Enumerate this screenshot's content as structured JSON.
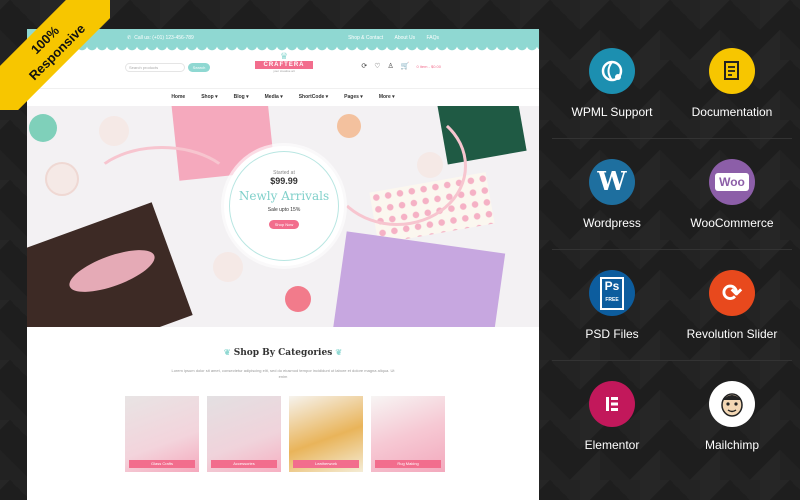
{
  "ribbon": {
    "line1": "100%",
    "line2": "Responsive"
  },
  "site": {
    "topbar": {
      "phone": "Call us: (+01) 123-456-789",
      "links": [
        "Shop & Contact",
        "About Us",
        "FAQs"
      ]
    },
    "search": {
      "placeholder": "Search products",
      "button": "Search"
    },
    "logo": {
      "name": "CRAFTERA",
      "tagline": "your creative art"
    },
    "cart": "0 item - $0.00",
    "nav": [
      "Home",
      "Shop ▾",
      "Blog ▾",
      "Media ▾",
      "ShortCode ▾",
      "Pages ▾",
      "More ▾"
    ],
    "hero": {
      "started": "Started at",
      "price": "$99.99",
      "title": "Newly Arrivals",
      "sale": "Sale upto 15%",
      "button": "Shop Now"
    },
    "categories": {
      "title": "Shop By Categories",
      "desc": "Lorem ipsum dolor sit amet, consectetur adipiscing elit, sed do eiusmod tempor incididunt ut labore et dolore magna aliqua. Ut enim",
      "items": [
        "Glass Crafts",
        "Accessories",
        "Leatherwork",
        "Rug Making"
      ]
    }
  },
  "features": [
    {
      "label": "WPML Support",
      "icon": "wpml-icon",
      "color": "#1c8fb0"
    },
    {
      "label": "Documentation",
      "icon": "documentation-icon",
      "color": "#f7c600"
    },
    {
      "label": "Wordpress",
      "icon": "wordpress-icon",
      "color": "#1e6f9f"
    },
    {
      "label": "WooCommerce",
      "icon": "woocommerce-icon",
      "color": "#8c5ea8"
    },
    {
      "label": "PSD Files",
      "icon": "psd-icon",
      "color": "#0d5d9e"
    },
    {
      "label": "Revolution Slider",
      "icon": "revolution-slider-icon",
      "color": "#e8491d"
    },
    {
      "label": "Elementor",
      "icon": "elementor-icon",
      "color": "#c2185b"
    },
    {
      "label": "Mailchimp",
      "icon": "mailchimp-icon",
      "color": "#ffffff"
    }
  ]
}
